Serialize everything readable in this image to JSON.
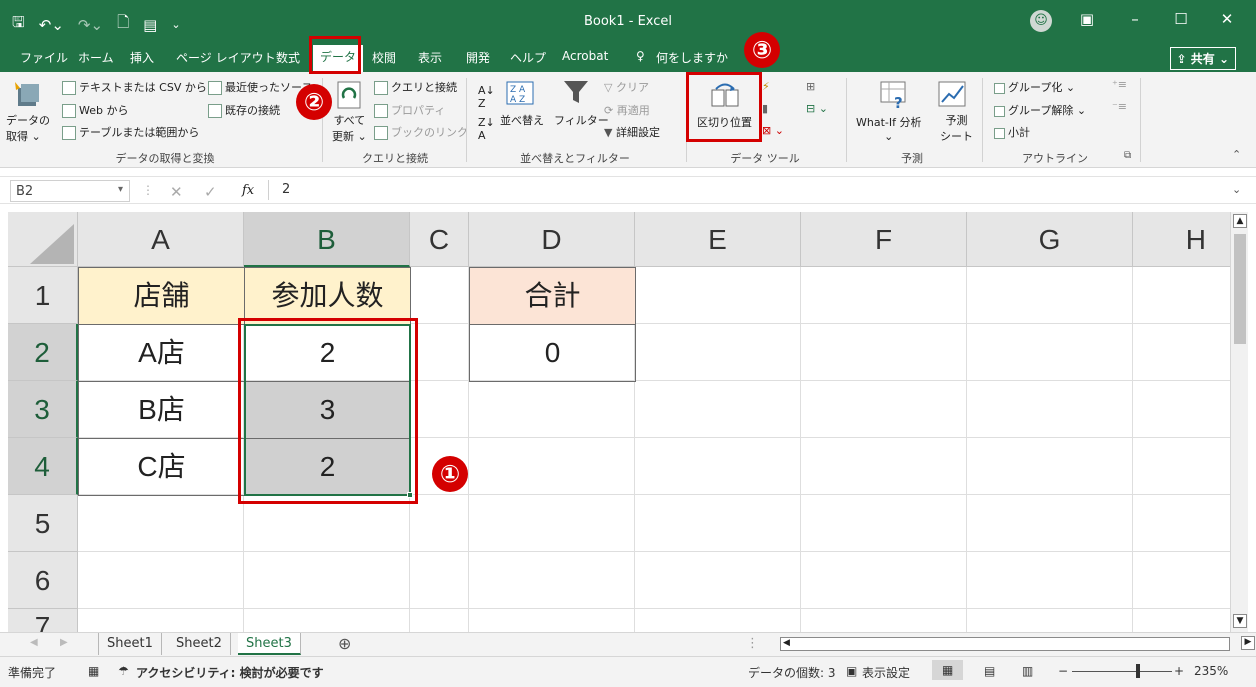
{
  "title": {
    "text": "Book1  -  Excel"
  },
  "tabs": [
    "ファイル",
    "ホーム",
    "挿入",
    "ページ レイアウト",
    "数式",
    "データ",
    "校閲",
    "表示",
    "開発",
    "ヘルプ",
    "Acrobat"
  ],
  "tell_me": "何をしますか",
  "share_label": "共有",
  "ribbon": {
    "get_data": {
      "big": "データの\n取得",
      "big1": "データの",
      "big2": "取得 ⌄",
      "text_csv": "テキストまたは CSV から",
      "web": "Web から",
      "table_range": "テーブルまたは範囲から",
      "recent": "最近使ったソース",
      "existing": "既存の接続",
      "group_label": "データの取得と変換"
    },
    "queries": {
      "refresh1": "すべて",
      "refresh2": "更新 ⌄",
      "queries_conn": "クエリと接続",
      "properties": "プロパティ",
      "edit_links": "ブックのリンク",
      "group_label": "クエリと接続"
    },
    "sort": {
      "sort_label": "並べ替え",
      "filter_label": "フィルター",
      "clear": "クリア",
      "reapply": "再適用",
      "advanced": "詳細設定",
      "group_label": "並べ替えとフィルター"
    },
    "tools": {
      "text_to_columns": "区切り位置",
      "group_label": "データ ツール"
    },
    "forecast": {
      "what_if": "What-If 分析",
      "what_if2": "⌄",
      "sheet1": "予測",
      "sheet2": "シート",
      "group_label": "予測"
    },
    "outline": {
      "group": "グループ化",
      "ungroup": "グループ解除",
      "subtotal": "小計",
      "group_label": "アウトライン"
    }
  },
  "formula_bar": {
    "name_box": "B2",
    "value": "2",
    "fx": "fx"
  },
  "columns": [
    "A",
    "B",
    "C",
    "D",
    "E",
    "F",
    "G",
    "H"
  ],
  "rows": [
    "1",
    "2",
    "3",
    "4",
    "5",
    "6",
    "7"
  ],
  "cells": {
    "A1": "店舗",
    "B1": "参加人数",
    "D1": "合計",
    "A2": "A店",
    "B2": "2",
    "D2": "0",
    "A3": "B店",
    "B3": "3",
    "A4": "C店",
    "B4": "2"
  },
  "annotations": {
    "one": "①",
    "two": "②",
    "three": "③"
  },
  "sheets": [
    "Sheet1",
    "Sheet2",
    "Sheet3"
  ],
  "active_sheet": "Sheet3",
  "status": {
    "ready": "準備完了",
    "accessibility": "アクセシビリティ: 検討が必要です",
    "count": "データの個数: 3",
    "display_settings": "表示設定",
    "zoom": "235%"
  },
  "colors": {
    "excel_green": "#217346",
    "annotation_red": "#d40000",
    "header_yellow": "#fff2cc",
    "header_peach": "#fce4d6"
  }
}
